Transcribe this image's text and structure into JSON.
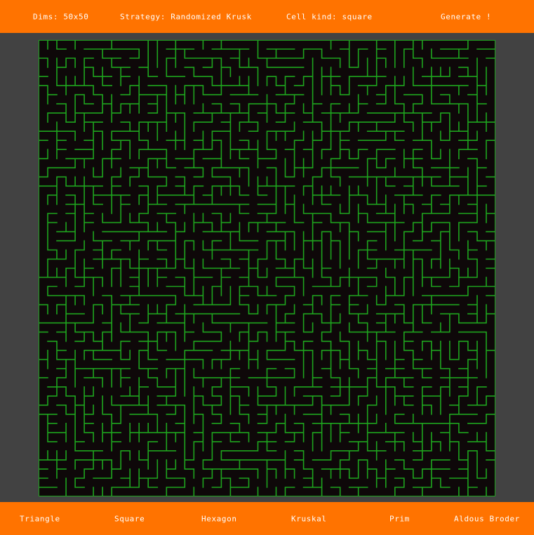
{
  "top_bar": {
    "dims": "Dims: 50x50",
    "strategy": "Strategy: Randomized Krusk",
    "cell_kind": "Cell kind: square",
    "generate": "Generate !"
  },
  "bottom_bar": {
    "triangle": "Triangle",
    "square": "Square",
    "hexagon": "Hexagon",
    "kruskal": "Kruskal",
    "prim": "Prim",
    "aldous_broder": "Aldous Broder"
  },
  "maze": {
    "rows": 50,
    "cols": 50,
    "wall_color": "#1ea51e",
    "background_color": "#0e0809"
  },
  "colors": {
    "accent": "#ff7300",
    "page_background": "#424242"
  }
}
